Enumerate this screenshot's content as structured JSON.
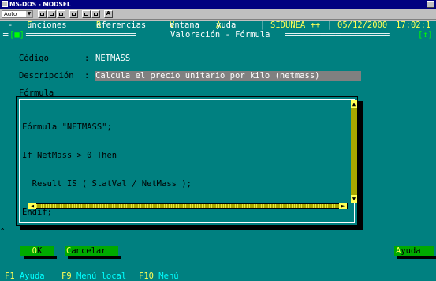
{
  "window": {
    "title": "MS-DOS - MODSEL"
  },
  "toolbar": {
    "font_value": "Auto",
    "font_dropdown_glyph": "▼",
    "bold_label": "A"
  },
  "menu": {
    "sys": "-",
    "items": [
      {
        "hot": "F",
        "rest": "unciones"
      },
      {
        "hot": "R",
        "rest": "eferencias"
      },
      {
        "hot": "V",
        "rest": "entana"
      },
      {
        "hot": "A",
        "rest": "yuda"
      }
    ],
    "app_name": "SIDUNEA ++",
    "date": "05/12/2000",
    "time": "17:02:1"
  },
  "dialog": {
    "close_glyph": "[■]",
    "title": "Valoración - Fórmula",
    "resize_glyph": "[↕]",
    "codigo_label": "Código",
    "codigo_sep": ":",
    "codigo_value": "NETMASS",
    "descripcion_label": "Descripción",
    "descripcion_sep": ":",
    "descripcion_value": "Calcula el precio unitario por kilo (netmass)",
    "formula_label": "Fórmula",
    "code_lines": [
      "Fórmula \"NETMASS\";",
      "If NetMass > 0 Then",
      "  Result IS ( StatVal / NetMass );",
      "Endif;"
    ],
    "scroll_up": "▲",
    "scroll_down": "▼",
    "scroll_left": "◄",
    "scroll_right": "►"
  },
  "buttons": {
    "ok_hot": "O",
    "ok_rest": "K",
    "cancel_hot": "C",
    "cancel_rest": "ancelar",
    "help_hot": "A",
    "help_rest": "yuda"
  },
  "statusbar": {
    "items": [
      {
        "key": "F1",
        "label": "Ayuda"
      },
      {
        "key": "F9",
        "label": "Menú local"
      },
      {
        "key": "F10",
        "label": "Menú"
      }
    ]
  }
}
